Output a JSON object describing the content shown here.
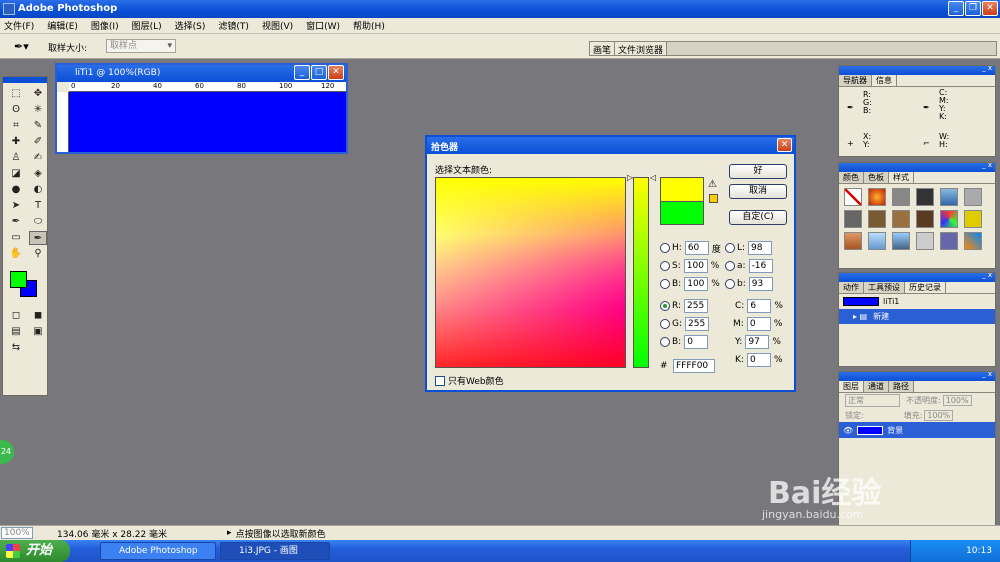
{
  "app": {
    "title": "Adobe Photoshop"
  },
  "menu": [
    "文件(F)",
    "编辑(E)",
    "图像(I)",
    "图层(L)",
    "选择(S)",
    "滤镜(T)",
    "视图(V)",
    "窗口(W)",
    "帮助(H)"
  ],
  "options": {
    "label": "取样大小:",
    "sample_value": "取样点"
  },
  "palette_well": [
    "画笔",
    "文件浏览器"
  ],
  "document": {
    "title": "liTi1 @ 100%(RGB)",
    "ruler_ticks": [
      "0",
      "20",
      "40",
      "60",
      "80",
      "100",
      "120"
    ],
    "canvas_color": "#0000ff"
  },
  "picker": {
    "title": "拾色器",
    "label": "选择文本颜色:",
    "ok": "好",
    "cancel": "取消",
    "custom": "自定(C)",
    "hsb": [
      {
        "key": "H:",
        "value": "60",
        "unit": "度"
      },
      {
        "key": "S:",
        "value": "100",
        "unit": "%"
      },
      {
        "key": "B:",
        "value": "100",
        "unit": "%"
      }
    ],
    "lab": [
      {
        "key": "L:",
        "value": "98"
      },
      {
        "key": "a:",
        "value": "-16"
      },
      {
        "key": "b:",
        "value": "93"
      }
    ],
    "rgb": [
      {
        "key": "R:",
        "value": "255"
      },
      {
        "key": "G:",
        "value": "255"
      },
      {
        "key": "B:",
        "value": "0"
      }
    ],
    "cmyk": [
      {
        "key": "C:",
        "value": "6",
        "unit": "%"
      },
      {
        "key": "M:",
        "value": "0",
        "unit": "%"
      },
      {
        "key": "Y:",
        "value": "97",
        "unit": "%"
      },
      {
        "key": "K:",
        "value": "0",
        "unit": "%"
      }
    ],
    "hex_label": "#",
    "hex": "FFFF00",
    "web_only": "只有Web颜色",
    "new_color": "#ffff00",
    "old_color": "#00ff00"
  },
  "palettes": {
    "nav_tabs": [
      "导航器",
      "信息"
    ],
    "info": {
      "rgb": "R:\nG:\nB:",
      "cmyk": "C:\nM:\nY:\nK:",
      "xy": "X:\nY:",
      "wh": "W:\nH:"
    },
    "color_tabs": [
      "颜色",
      "色板",
      "样式"
    ],
    "history_tabs": [
      "动作",
      "工具预设",
      "历史记录"
    ],
    "history": {
      "doc": "liTi1",
      "step": "新建"
    },
    "layer_tabs": [
      "图层",
      "通道",
      "路径"
    ],
    "layers": {
      "mode": "正常",
      "opacity_label": "不透明度:",
      "opacity": "100%",
      "lock_label": "锁定:",
      "fill_label": "填充:",
      "fill": "100%",
      "layer_name": "背景"
    }
  },
  "status": {
    "zoom": "100%",
    "size": "134.06 毫米 x 28.22 毫米",
    "hint": "点按图像以选取新颜色"
  },
  "taskbar": {
    "start": "开始",
    "items": [
      "Adobe Photoshop",
      "1i3.JPG - 画图"
    ],
    "clock": "10:13"
  },
  "badge": "24",
  "watermark": {
    "main": "Bai经验",
    "sub": "jingyan.baidu.com"
  },
  "colors": {
    "foreground": "#00ff00",
    "background": "#0000ff",
    "titlebar": "#0a4fd6"
  }
}
